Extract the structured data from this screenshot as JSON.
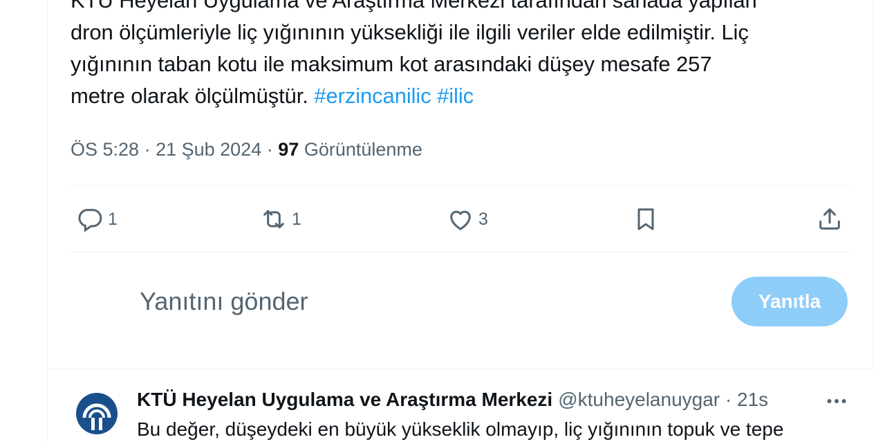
{
  "tweet": {
    "lines": [
      "KTÜ Heyelan Uygulama ve Araştırma Merkezi tarafından sahada yapılan",
      "dron ölçümleriyle liç yığınının yüksekliği ile ilgili veriler elde edilmiştir. Liç",
      "yığınının taban kotu ile maksimum kot arasındaki düşey mesafe 257",
      "metre olarak ölçülmüştür."
    ],
    "hashtags": [
      "#erzincanilic",
      "#ilic"
    ],
    "time": "ÖS 5:28",
    "date": "21 Şub 2024",
    "views_count": "97",
    "views_label": "Görüntülenme",
    "separator": "·"
  },
  "actions": {
    "reply_count": "1",
    "retweet_count": "1",
    "like_count": "3"
  },
  "composer": {
    "placeholder": "Yanıtını gönder",
    "button_label": "Yanıtla"
  },
  "reply": {
    "name": "KTÜ Heyelan Uygulama ve Araştırma Merkezi",
    "handle": "@ktuheyelanuygar · 21s",
    "text": "Bu değer, düşeydeki en büyük yükseklik olmayıp, liç yığınının topuk ve tepe"
  },
  "colors": {
    "accent": "#1d9bf0",
    "secondary_text": "#536471",
    "reply_button_bg": "#8ecdf8",
    "avatar_blue": "#1a4f8b"
  },
  "icons": [
    "reply-icon",
    "retweet-icon",
    "like-icon",
    "bookmark-icon",
    "share-icon",
    "more-icon"
  ]
}
